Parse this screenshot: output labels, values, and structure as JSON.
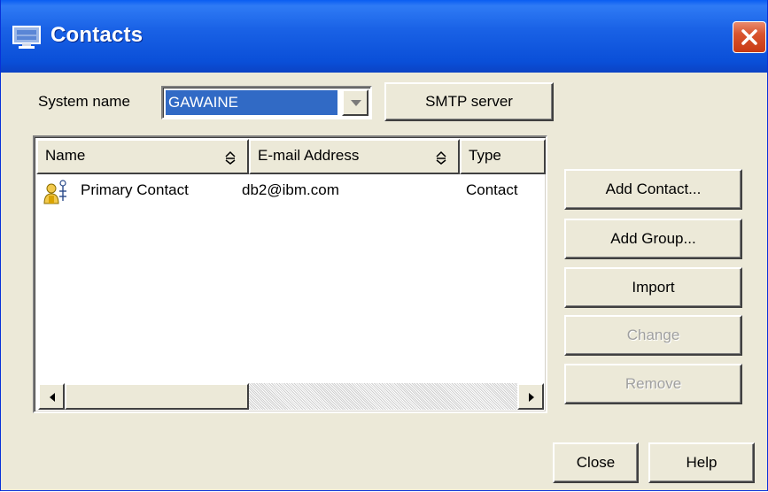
{
  "window": {
    "title": "Contacts",
    "title_icon": "monitor-icon",
    "close_icon": "close-icon"
  },
  "form": {
    "system_name_label": "System name",
    "system_name_value": "GAWAINE",
    "smtp_button": "SMTP server"
  },
  "table": {
    "columns": [
      "Name",
      "E-mail Address",
      "Type"
    ],
    "sort_icon": "sort-updown-icon",
    "rows": [
      {
        "icon": "contact-person-icon",
        "name": "Primary Contact",
        "email": "db2@ibm.com",
        "type": "Contact"
      }
    ]
  },
  "side_buttons": {
    "add_contact": "Add Contact...",
    "add_group": "Add Group...",
    "import": "Import",
    "change": "Change",
    "remove": "Remove"
  },
  "footer": {
    "close": "Close",
    "help": "Help"
  },
  "colors": {
    "titlebar": "#0a4fd8",
    "selection": "#316ac5",
    "background": "#ece9d8",
    "close_button": "#d9542e"
  }
}
